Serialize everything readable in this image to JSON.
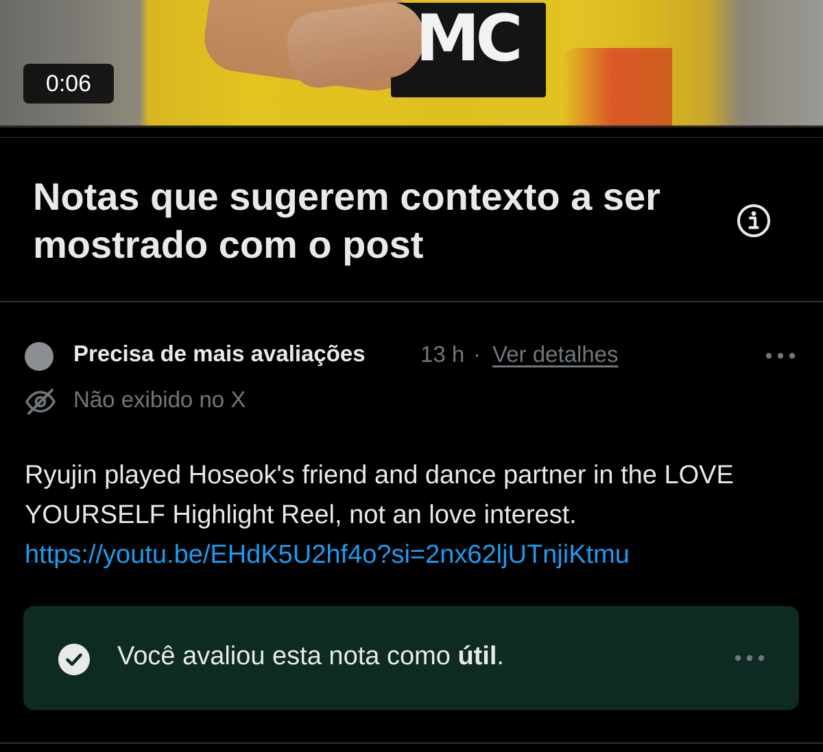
{
  "video": {
    "duration": "0:06",
    "patch_text": "MC"
  },
  "header": {
    "title": "Notas que sugerem contexto a ser mostrado com o post",
    "info_icon": "info-circle-icon"
  },
  "note": {
    "status_label": "Precisa de mais avaliações",
    "time": "13 h",
    "separator": "·",
    "details_link": "Ver detalhes",
    "more_icon": "more-horizontal-icon",
    "visibility_icon": "eye-off-icon",
    "visibility_text": "Não exibido no X",
    "body_text": "Ryujin played Hoseok's friend and dance partner in the LOVE YOURSELF Highlight Reel, not an love interest.",
    "link": "https://youtu.be/EHdK5U2hf4o?si=2nx62ljUTnjiKtmu"
  },
  "rating": {
    "check_icon": "check-circle-icon",
    "text_prefix": "Você avaliou esta nota como ",
    "text_bold": "útil",
    "text_suffix": ".",
    "more_icon": "more-horizontal-icon"
  },
  "colors": {
    "background": "#000000",
    "primary_text": "#e7e9ea",
    "secondary_text": "#71767b",
    "link": "#1d9bf0",
    "divider": "#2f3336",
    "rating_box": "#0d2b23",
    "status_dot": "#8b8f94"
  }
}
